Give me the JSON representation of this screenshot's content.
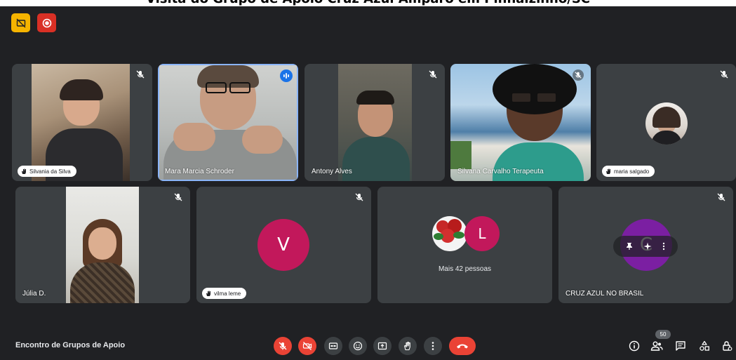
{
  "banner": {
    "title": "Visita do Grupo de Apoio Cruz Azul Amparo em Pinhalzinho/SC"
  },
  "status_badges": [
    {
      "icon": "captions-off-icon",
      "color": "#f5b400"
    },
    {
      "icon": "recording-icon",
      "color": "#d93025"
    }
  ],
  "participants": [
    {
      "name": "Silvania da Silva",
      "label_style": "chip",
      "muted": true
    },
    {
      "name": "Mara Marcia Schroder",
      "label_style": "plain",
      "speaking": true
    },
    {
      "name": "Antony Alves",
      "label_style": "plain",
      "muted": true
    },
    {
      "name": "Silvana Carvalho Terapeuta",
      "label_style": "plain",
      "muted": true
    },
    {
      "name": "maria salgado",
      "label_style": "chip",
      "muted": true
    },
    {
      "name": "Júlia D.",
      "label_style": "plain",
      "muted": true
    },
    {
      "name": "vilma leme",
      "label_style": "chip",
      "muted": true,
      "avatar_letter": "V",
      "avatar_color": "#c2185b"
    },
    {
      "name": "CRUZ AZUL NO BRASIL",
      "label_style": "plain",
      "muted": true,
      "avatar_letter": "C",
      "avatar_color": "#7b1fa2"
    }
  ],
  "others_tile": {
    "avatar_letter": "L",
    "avatar_color": "#c2185b",
    "label": "Mais 42 pessoas"
  },
  "meeting": {
    "title": "Encontro de Grupos de Apoio",
    "participant_count": "50"
  },
  "controls": [
    {
      "icon": "mic-off-icon",
      "active_red": true
    },
    {
      "icon": "camera-off-icon",
      "active_red": true
    },
    {
      "icon": "captions-icon"
    },
    {
      "icon": "emoji-icon"
    },
    {
      "icon": "present-screen-icon"
    },
    {
      "icon": "raise-hand-icon"
    },
    {
      "icon": "more-options-icon"
    },
    {
      "icon": "hang-up-icon"
    }
  ],
  "utilities": [
    {
      "icon": "info-icon"
    },
    {
      "icon": "people-icon"
    },
    {
      "icon": "chat-icon"
    },
    {
      "icon": "activities-icon"
    },
    {
      "icon": "host-controls-icon"
    }
  ],
  "colors": {
    "background": "#202124",
    "tile": "#3c4043",
    "danger": "#ea4335",
    "speaking_border": "#8ab4f8"
  }
}
